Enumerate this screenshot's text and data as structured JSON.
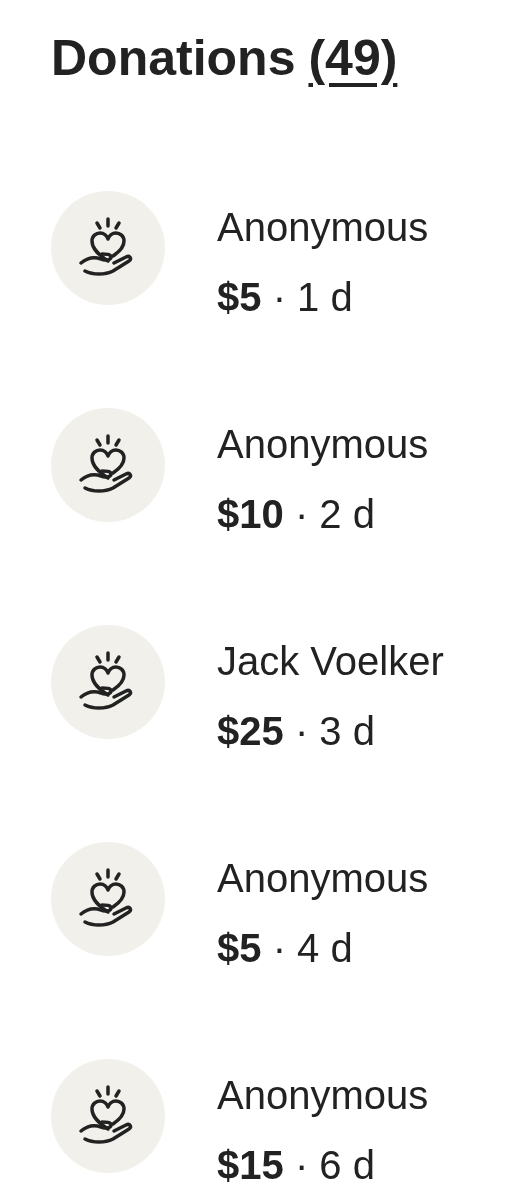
{
  "header": {
    "title": "Donations",
    "count": "(49)"
  },
  "donations": [
    {
      "name": "Anonymous",
      "amount": "$5",
      "separator": "·",
      "time": "1 d"
    },
    {
      "name": "Anonymous",
      "amount": "$10",
      "separator": "·",
      "time": "2 d"
    },
    {
      "name": "Jack Voelker",
      "amount": "$25",
      "separator": "·",
      "time": "3 d"
    },
    {
      "name": "Anonymous",
      "amount": "$5",
      "separator": "·",
      "time": "4 d"
    },
    {
      "name": "Anonymous",
      "amount": "$15",
      "separator": "·",
      "time": "6 d"
    }
  ]
}
